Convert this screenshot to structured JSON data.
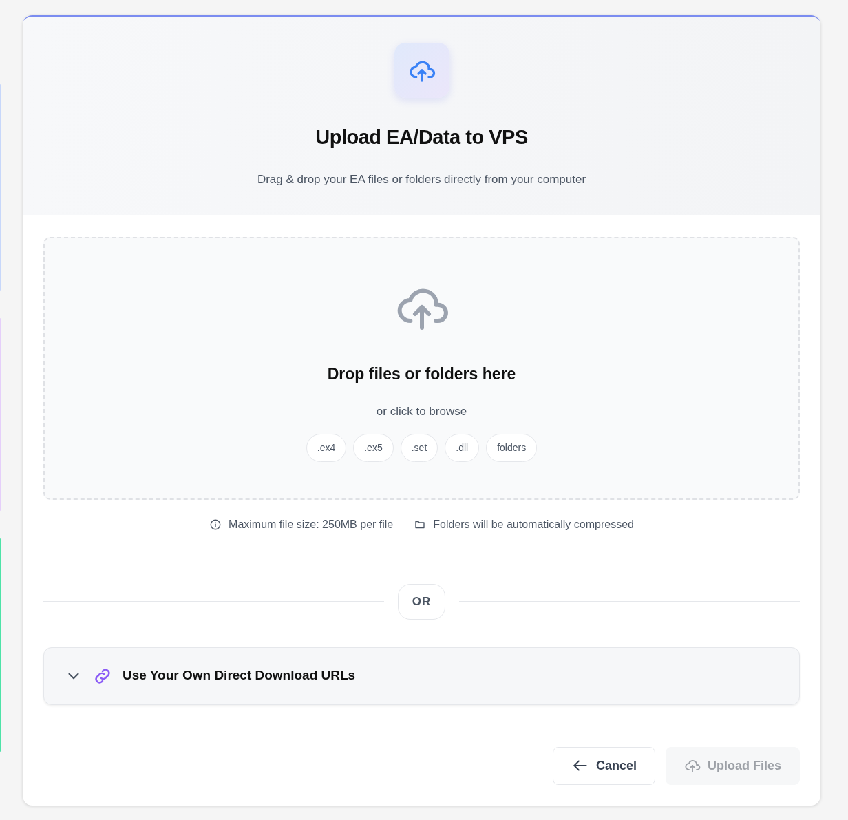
{
  "header": {
    "title": "Upload EA/Data to VPS",
    "subtitle": "Drag & drop your EA files or folders directly from your computer"
  },
  "dropzone": {
    "title": "Drop files or folders here",
    "subtitle": "or click to browse",
    "chips": [
      ".ex4",
      ".ex5",
      ".set",
      ".dll",
      "folders"
    ]
  },
  "notes": [
    {
      "kind": "info",
      "text": "Maximum file size: 250MB per file"
    },
    {
      "kind": "folder",
      "text": "Folders will be automatically compressed"
    }
  ],
  "divider": {
    "label": "OR"
  },
  "url_section": {
    "label": "Use Your Own Direct Download URLs",
    "expanded": false
  },
  "buttons": [
    {
      "kind": "cancel",
      "label": "Cancel",
      "disabled": false
    },
    {
      "kind": "upload",
      "label": "Upload Files",
      "disabled": true
    }
  ]
}
